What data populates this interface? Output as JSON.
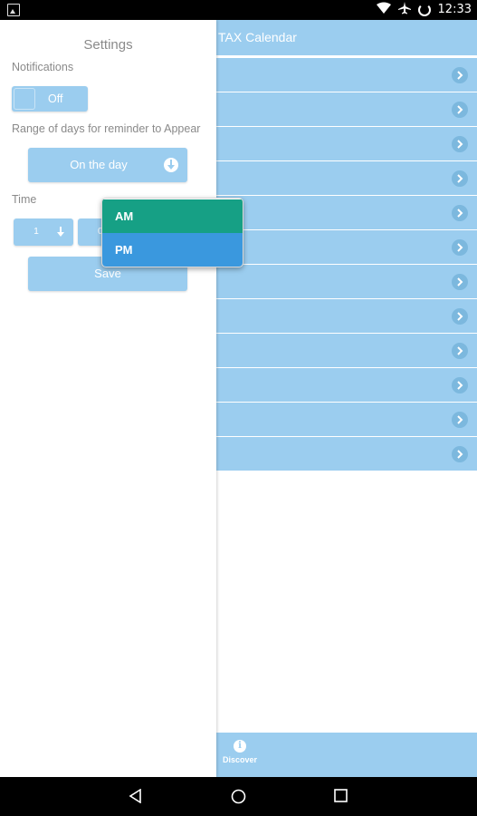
{
  "status_bar": {
    "time": "12:33",
    "icons": [
      "image-notification-icon",
      "wifi-icon",
      "airplane-mode-icon",
      "battery-icon"
    ]
  },
  "settings": {
    "title": "Settings",
    "notifications_label": "Notifications",
    "notifications_toggle": {
      "label": "Off",
      "on": false
    },
    "range_label": "Range of days for reminder to Appear",
    "range_value": "On the day",
    "time_label": "Time",
    "hour_value": "1",
    "minute_value": "0",
    "save_label": "Save"
  },
  "ampm_popup": {
    "options": [
      "AM",
      "PM"
    ],
    "colors": {
      "am": "#16a085",
      "pm": "#3a98de"
    }
  },
  "main": {
    "title": "TAX Calendar",
    "row_count": 12,
    "footer": {
      "discover_label": "Discover",
      "discover_icon": "info-icon"
    }
  },
  "colors": {
    "accent": "#9bcdef",
    "text_grey": "#8a8a8a"
  },
  "nav_bar": {
    "icons": [
      "back-icon",
      "home-icon",
      "recents-icon"
    ]
  }
}
